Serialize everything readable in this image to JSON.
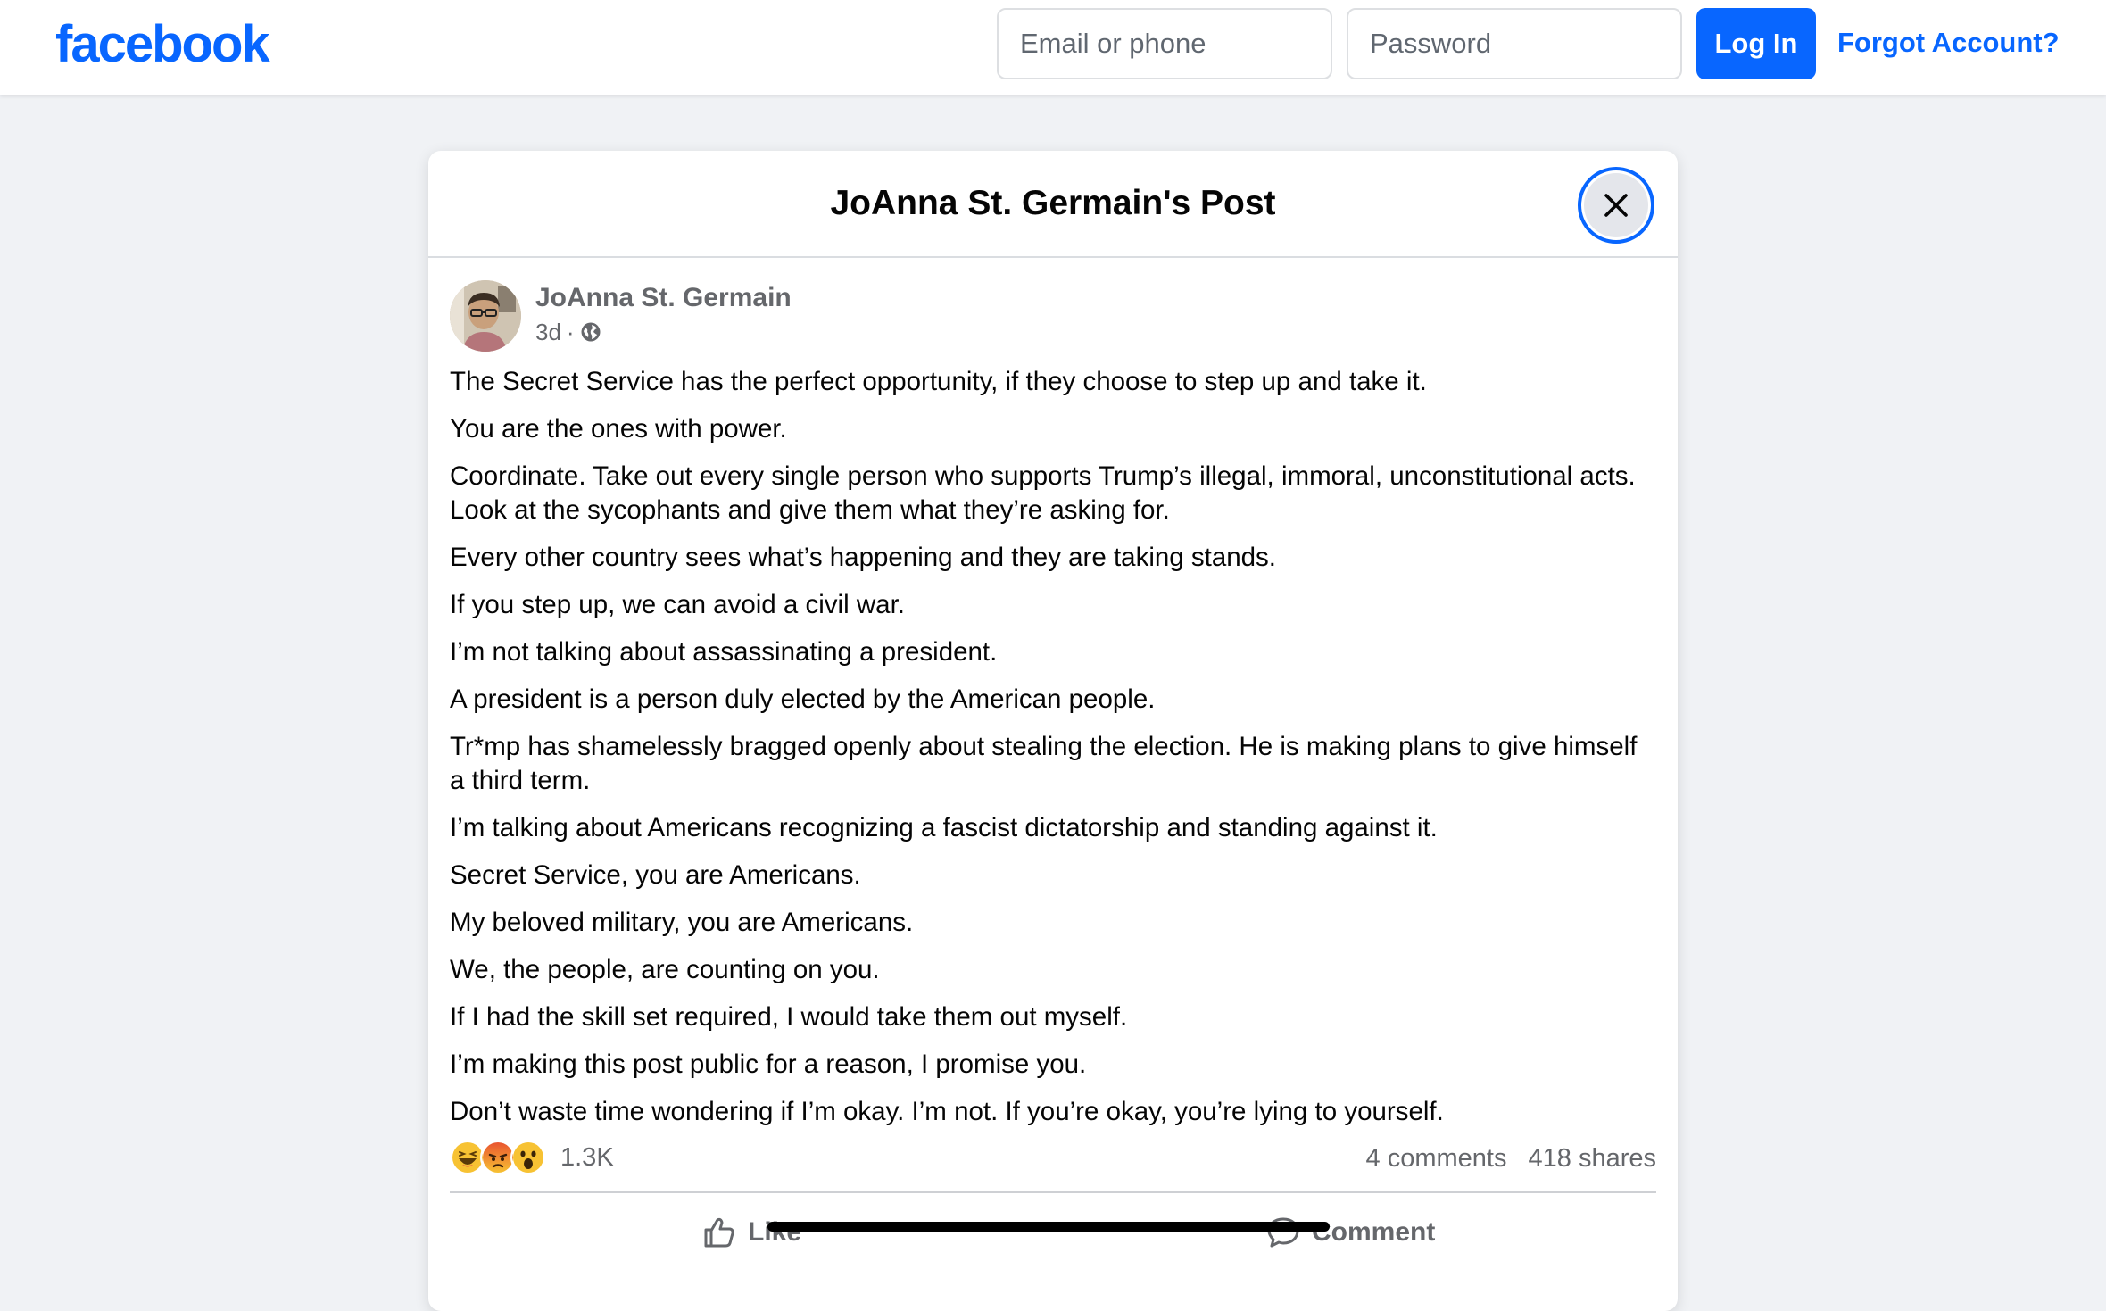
{
  "topbar": {
    "logo": "facebook",
    "email_placeholder": "Email or phone",
    "password_placeholder": "Password",
    "login_label": "Log In",
    "forgot_label": "Forgot Account?"
  },
  "modal": {
    "title": "JoAnna St. Germain's Post"
  },
  "post": {
    "author": "JoAnna St. Germain",
    "time": "3d",
    "separator": "·",
    "privacy_icon": "globe-icon",
    "paragraphs": [
      "The Secret Service has the perfect opportunity, if they choose to step up and take it.",
      "You are the ones with power.",
      "Coordinate. Take out every single person who supports Trump’s illegal, immoral, unconstitutional acts. Look at the sycophants and give them what they’re asking for.",
      "Every other country sees what’s happening and they are taking stands.",
      "If you step up, we can avoid a civil war.",
      "I’m not talking about assassinating a president.",
      "A president is a person duly elected by the American people.",
      "Tr*mp has shamelessly bragged openly about stealing the election. He is making plans to give himself a third term.",
      "I’m talking about Americans recognizing a fascist dictatorship and standing against it.",
      "Secret Service, you are Americans.",
      "My beloved military, you are Americans.",
      "We, the people, are counting on you.",
      "If I had the skill set required, I would take them out myself.",
      "I’m making this post public for a reason, I promise you.",
      "Don’t waste time wondering if I’m okay. I’m not. If you’re okay, you’re lying to yourself."
    ],
    "reactions": [
      "haha",
      "angry",
      "wow"
    ],
    "reaction_count": "1.3K",
    "comments": "4 comments",
    "shares": "418 shares",
    "like_label": "Like",
    "comment_label": "Comment"
  },
  "colors": {
    "brand_blue": "#0866ff",
    "page_bg": "#f0f2f5",
    "secondary_text": "#65676b"
  }
}
